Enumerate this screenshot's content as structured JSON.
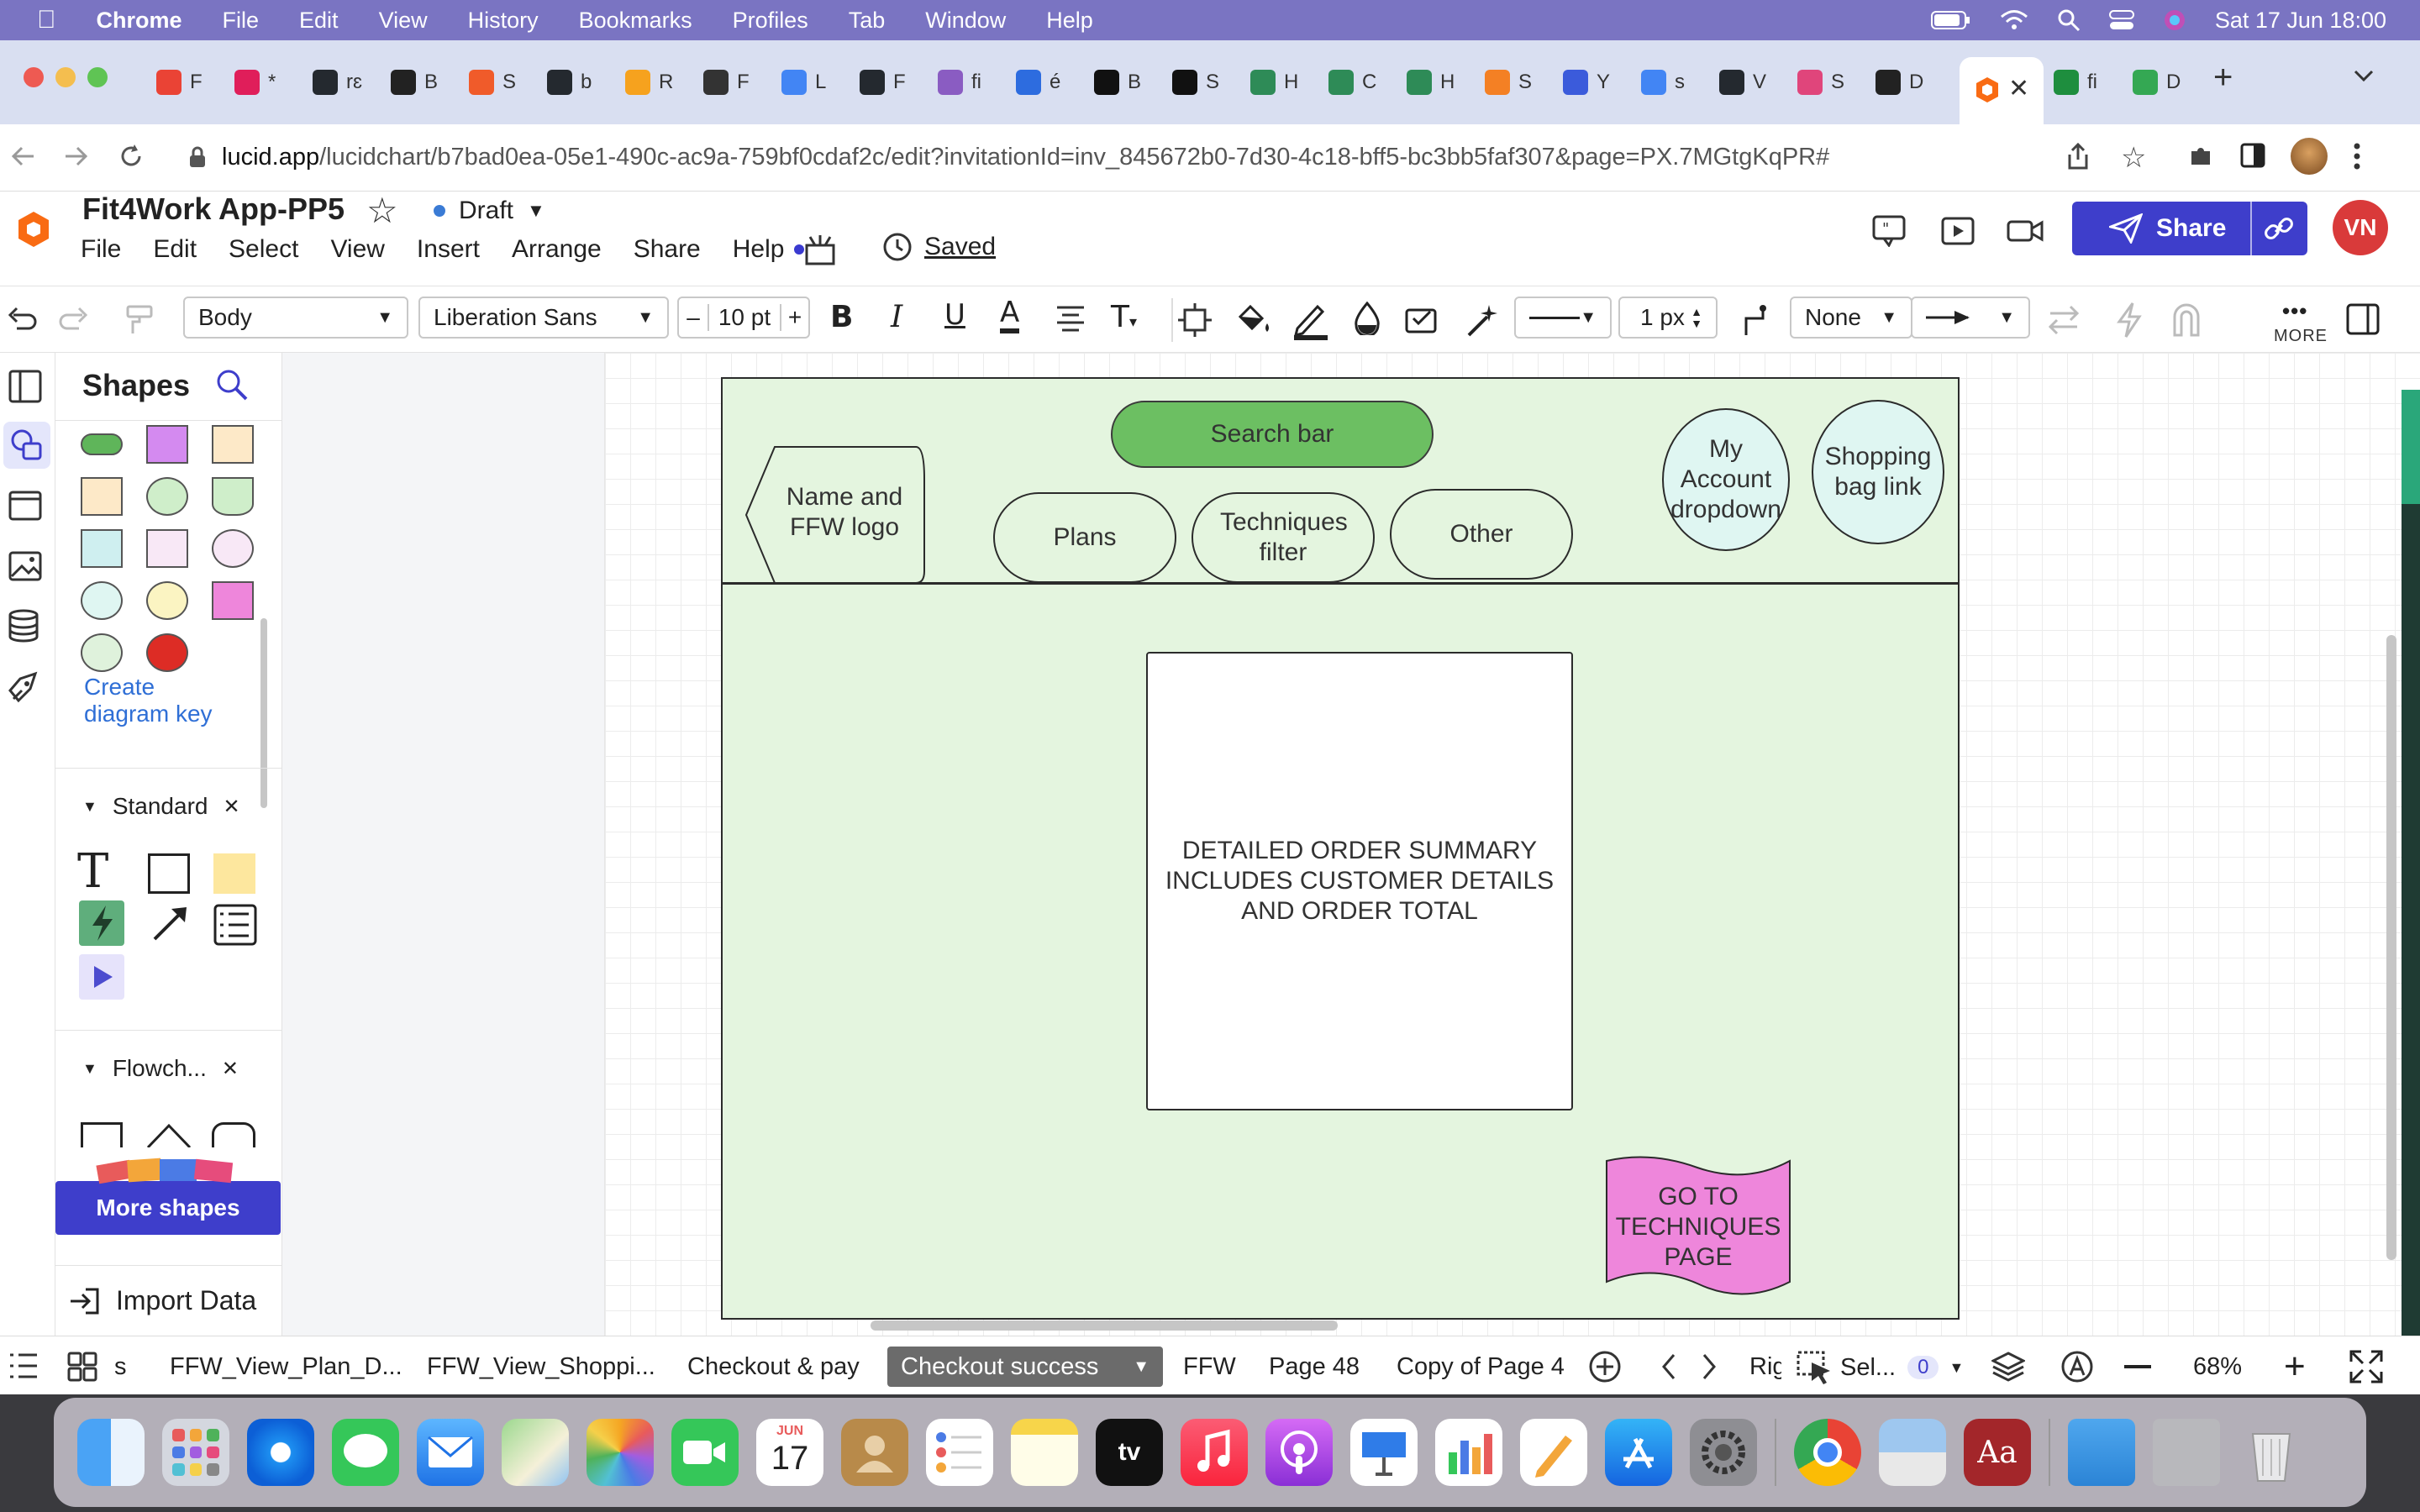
{
  "menubar": {
    "app": "Chrome",
    "items": [
      "File",
      "Edit",
      "View",
      "History",
      "Bookmarks",
      "Profiles",
      "Tab",
      "Window",
      "Help"
    ],
    "datetime": "Sat 17 Jun  18:00"
  },
  "tabs": [
    {
      "label": "F",
      "color": "#ea4335"
    },
    {
      "label": "*",
      "color": "#e01e5a"
    },
    {
      "label": "rɛ",
      "color": "#24292f"
    },
    {
      "label": "B",
      "color": "#222"
    },
    {
      "label": "S",
      "color": "#f05b2a"
    },
    {
      "label": "b",
      "color": "#24292f"
    },
    {
      "label": "R",
      "color": "#f6a21e"
    },
    {
      "label": "F",
      "color": "#333"
    },
    {
      "label": "L",
      "color": "#4285f4"
    },
    {
      "label": "F",
      "color": "#24292f"
    },
    {
      "label": "fi",
      "color": "#8a5cc2"
    },
    {
      "label": "é",
      "color": "#2d6cdf"
    },
    {
      "label": "B",
      "color": "#111"
    },
    {
      "label": "S",
      "color": "#111"
    },
    {
      "label": "H",
      "color": "#2e8b57"
    },
    {
      "label": "C",
      "color": "#2e8b57"
    },
    {
      "label": "H",
      "color": "#2e8b57"
    },
    {
      "label": "S",
      "color": "#f48024"
    },
    {
      "label": "Y",
      "color": "#3b5bdb"
    },
    {
      "label": "s",
      "color": "#4285f4"
    },
    {
      "label": "V",
      "color": "#24292f"
    },
    {
      "label": "S",
      "color": "#e0457b"
    },
    {
      "label": "D",
      "color": "#222"
    }
  ],
  "active_tab_icon": "lucid-icon",
  "tabs_after": [
    {
      "label": "fi",
      "color": "#1e8e3e"
    },
    {
      "label": "D",
      "color": "#34a853"
    }
  ],
  "address": {
    "host": "lucid.app",
    "path": "/lucidchart/b7bad0ea-05e1-490c-ac9a-759bf0cdaf2c/edit?invitationId=inv_845672b0-7d30-4c18-bff5-bc3bb5faf307&page=PX.7MGtgKqPR#"
  },
  "lucid": {
    "title": "Fit4Work App-PP5",
    "status": "Draft",
    "menu": [
      "File",
      "Edit",
      "Select",
      "View",
      "Insert",
      "Arrange",
      "Share",
      "Help"
    ],
    "saved": "Saved",
    "share": "Share",
    "avatar": "VN"
  },
  "toolbar": {
    "style": "Body",
    "font": "Liberation Sans",
    "size": "10 pt",
    "minus": "–",
    "plus": "+",
    "line_width": "1 px",
    "arrow_start": "None",
    "more": "MORE"
  },
  "shapes_panel": {
    "title": "Shapes",
    "create_key": "Create diagram key",
    "section_standard": "Standard",
    "section_flowchart": "Flowch...",
    "more_shapes": "More shapes",
    "import": "Import Data"
  },
  "diagram": {
    "search_bar": "Search bar",
    "name_logo": "Name and FFW logo",
    "plans": "Plans",
    "techniques": "Techniques filter",
    "other": "Other",
    "account": "My Account dropdown",
    "bag": "Shopping bag link",
    "summary": "DETAILED ORDER SUMMARY INCLUDES CUSTOMER DETAILS AND ORDER TOTAL",
    "goto": "GO TO TECHNIQUES PAGE"
  },
  "pages": {
    "items": [
      "s",
      "FFW_View_Plan_D...",
      "FFW_View_Shoppi...",
      "Checkout & pay",
      "Checkout success",
      "FFW",
      "Page 48",
      "Copy of Page 4"
    ],
    "active": "Checkout success",
    "zoom": "68%",
    "select_label": "Sel...",
    "select_count": "0",
    "rig": "Rig"
  },
  "dock": {
    "calendar_month": "JUN",
    "calendar_day": "17",
    "tv": "tv",
    "dict": "Aa"
  }
}
